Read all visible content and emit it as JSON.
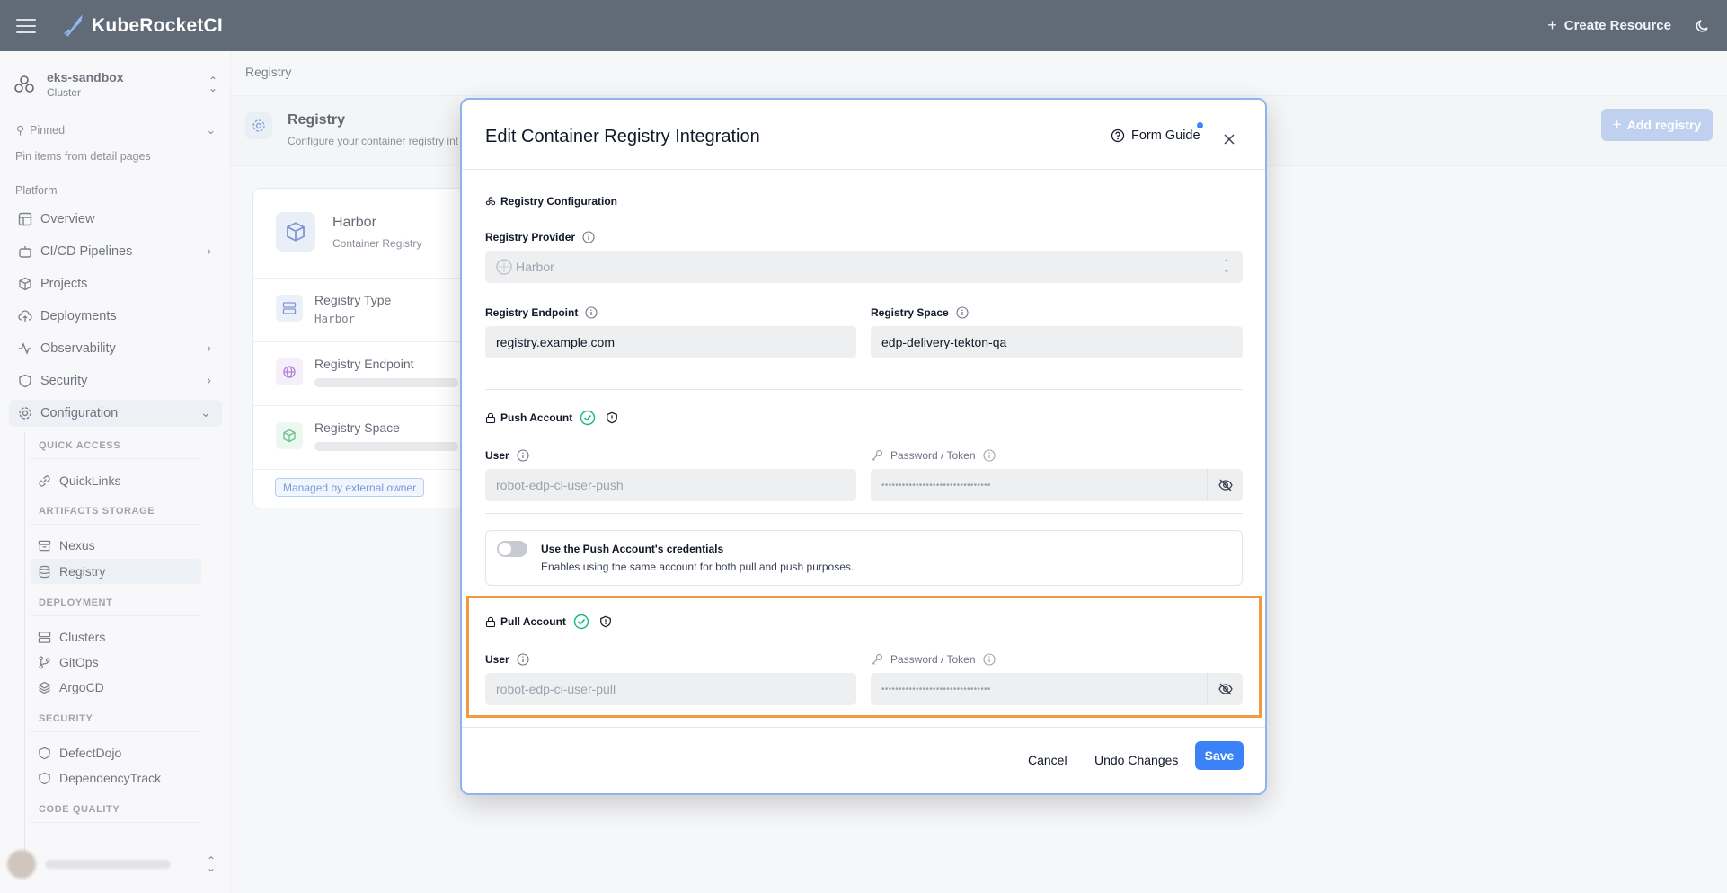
{
  "app": {
    "name": "KubeRocketCI",
    "create_label": "Create Resource"
  },
  "cluster": {
    "name": "eks-sandbox",
    "type": "Cluster"
  },
  "sidebar": {
    "pinned_label": "Pinned",
    "pinned_hint": "Pin items from detail pages",
    "platform_label": "Platform",
    "items": {
      "overview": "Overview",
      "cicd": "CI/CD Pipelines",
      "projects": "Projects",
      "deployments": "Deployments",
      "observability": "Observability",
      "security": "Security",
      "configuration": "Configuration"
    },
    "groups": {
      "quick_access": "QUICK ACCESS",
      "artifacts": "ARTIFACTS STORAGE",
      "deployment": "DEPLOYMENT",
      "security": "SECURITY",
      "code_quality": "CODE QUALITY"
    },
    "subitems": {
      "quicklinks": "QuickLinks",
      "nexus": "Nexus",
      "registry": "Registry",
      "clusters": "Clusters",
      "gitops": "GitOps",
      "argocd": "ArgoCD",
      "defectdojo": "DefectDojo",
      "dependencytrack": "DependencyTrack"
    }
  },
  "main": {
    "breadcrumb": "Registry",
    "title": "Registry",
    "subtitle": "Configure your container registry int",
    "add_button": "Add registry",
    "card": {
      "title": "Harbor",
      "subtitle": "Container Registry",
      "type_label": "Registry Type",
      "type_value": "Harbor",
      "endpoint_label": "Registry Endpoint",
      "space_label": "Registry Space",
      "badge": "Managed by external owner"
    }
  },
  "modal": {
    "title": "Edit Container Registry Integration",
    "form_guide": "Form Guide",
    "registry_config": "Registry Configuration",
    "provider_label": "Registry Provider",
    "provider_value": "Harbor",
    "endpoint_label": "Registry Endpoint",
    "endpoint_value": "registry.example.com",
    "space_label": "Registry Space",
    "space_value": "edp-delivery-tekton-qa",
    "push_account": "Push Account",
    "pull_account": "Pull Account",
    "user_label": "User",
    "password_label": "Password / Token",
    "push_user": "robot-edp-ci-user-push",
    "push_password": "••••••••••••••••••••••••••••••••",
    "pull_user": "robot-edp-ci-user-pull",
    "pull_password": "••••••••••••••••••••••••••••••••",
    "toggle_title": "Use the Push Account's credentials",
    "toggle_sub": "Enables using the same account for both pull and push purposes.",
    "cancel": "Cancel",
    "undo": "Undo Changes",
    "save": "Save"
  },
  "colors": {
    "accent": "#3b82f6",
    "highlight": "#f19a3e",
    "success": "#10b981",
    "topbar": "#0d1b2e"
  }
}
